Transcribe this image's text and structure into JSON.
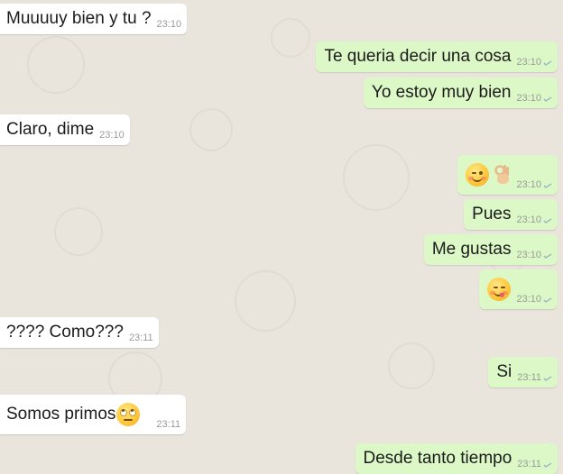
{
  "messages": [
    {
      "text": "Muuuuy bien y tu ?",
      "time": "23:10"
    },
    {
      "text": "Te queria decir una cosa",
      "time": "23:10"
    },
    {
      "text": "Yo estoy muy bien",
      "time": "23:10"
    },
    {
      "text": "Claro, dime",
      "time": "23:10"
    },
    {
      "text": "",
      "time": "23:10",
      "emojis": [
        "wink-emoji",
        "ok-hand-emoji"
      ]
    },
    {
      "text": "Pues",
      "time": "23:10"
    },
    {
      "text": "Me gustas",
      "time": "23:10"
    },
    {
      "text": "",
      "time": "23:10",
      "emojis": [
        "yum-emoji"
      ]
    },
    {
      "text": "???? Como???",
      "time": "23:11"
    },
    {
      "text": "Si",
      "time": "23:11"
    },
    {
      "text": "Somos primos",
      "time": "23:11",
      "emojis": [
        "rolling-eyes-emoji"
      ]
    },
    {
      "text": "Desde tanto tiempo",
      "time": "23:11"
    }
  ],
  "colors": {
    "incoming_bubble": "#ffffff",
    "outgoing_bubble": "#dcf8c6",
    "wallpaper": "#e9e4dc",
    "tick": "#8fb3c9",
    "timestamp": "#9a9a9a"
  }
}
